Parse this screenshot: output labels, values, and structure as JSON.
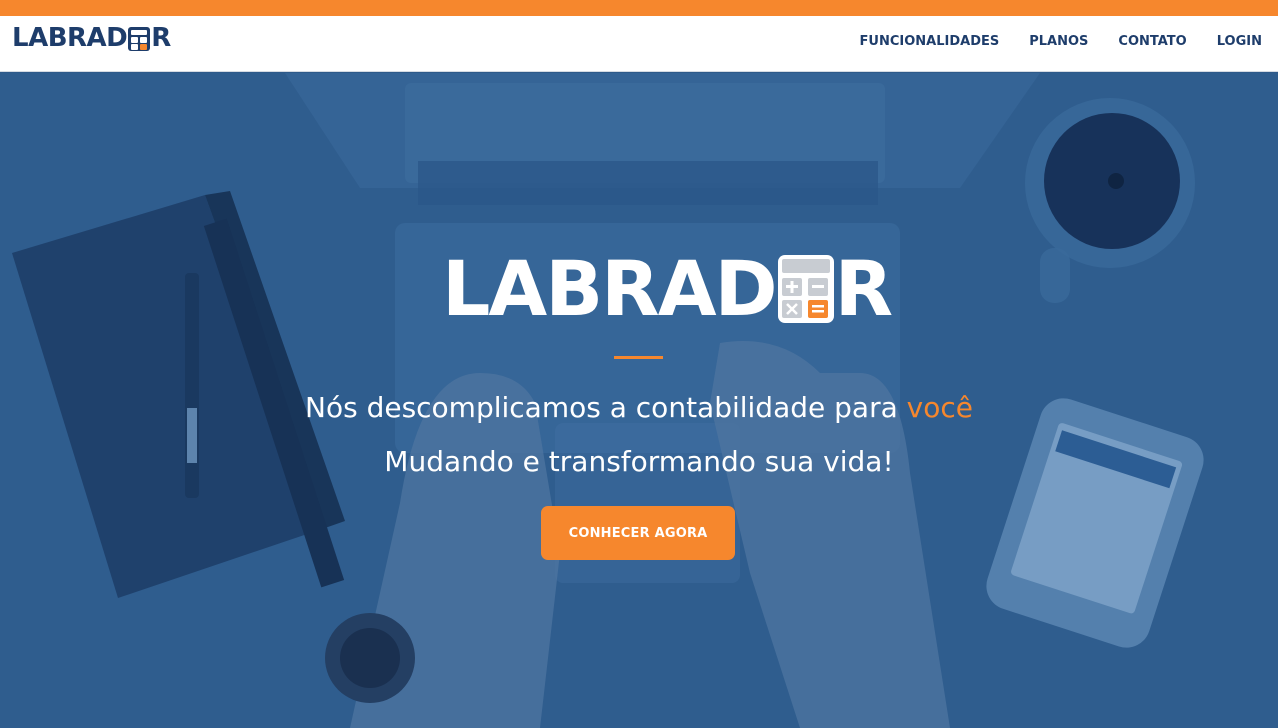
{
  "brand": {
    "name_left": "LABRAD",
    "name_right": "R"
  },
  "nav": {
    "items": [
      {
        "label": "FUNCIONALIDADES"
      },
      {
        "label": "PLANOS"
      },
      {
        "label": "CONTATO"
      },
      {
        "label": "LOGIN"
      }
    ]
  },
  "hero": {
    "logo_left": "LABRAD",
    "logo_right": "R",
    "tagline_main": "Nós descomplicamos a contabilidade para ",
    "tagline_accent": "você",
    "subtitle": "Mudando e transformando sua vida!",
    "cta_label": "CONHECER AGORA"
  },
  "colors": {
    "accent": "#f6872d",
    "navy": "#1e3d6b",
    "hero_overlay": "#2f5d8e",
    "white": "#ffffff"
  },
  "icons": [
    "calculator-icon"
  ]
}
